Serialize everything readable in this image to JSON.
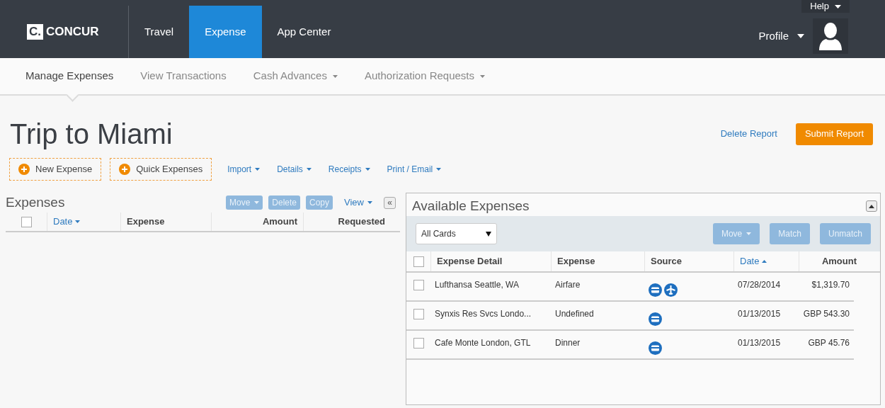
{
  "top_nav": {
    "logo": {
      "mark": "C.",
      "text": "CONCUR"
    },
    "tabs": [
      {
        "label": "Travel",
        "selected": false
      },
      {
        "label": "Expense",
        "selected": true
      },
      {
        "label": "App Center",
        "selected": false
      }
    ],
    "help": "Help",
    "profile": "Profile"
  },
  "sub_nav": [
    {
      "label": "Manage Expenses",
      "selected": true,
      "dropdown": false
    },
    {
      "label": "View Transactions",
      "selected": false,
      "dropdown": false
    },
    {
      "label": "Cash Advances",
      "selected": false,
      "dropdown": true
    },
    {
      "label": "Authorization Requests",
      "selected": false,
      "dropdown": true
    }
  ],
  "report": {
    "title": "Trip to Miami",
    "delete_link": "Delete Report",
    "submit_button": "Submit Report"
  },
  "actions": [
    {
      "kind": "add",
      "label": "New Expense"
    },
    {
      "kind": "add",
      "label": "Quick Expenses"
    },
    {
      "kind": "menu",
      "label": "Import"
    },
    {
      "kind": "menu",
      "label": "Details"
    },
    {
      "kind": "menu",
      "label": "Receipts"
    },
    {
      "kind": "menu",
      "label": "Print / Email"
    }
  ],
  "expenses": {
    "title": "Expenses",
    "buttons": [
      {
        "label": "Move",
        "dropdown": true,
        "disabled": true
      },
      {
        "label": "Delete",
        "dropdown": false,
        "disabled": true
      },
      {
        "label": "Copy",
        "dropdown": false,
        "disabled": true
      }
    ],
    "view": "View",
    "collapse": "«",
    "select_all_checked": false,
    "columns": [
      {
        "label": "Date",
        "sorted": true,
        "ascending": false
      },
      {
        "label": "Expense",
        "sorted": false
      },
      {
        "label": "Amount",
        "sorted": false
      },
      {
        "label": "Requested",
        "sorted": false
      }
    ]
  },
  "available": {
    "title": "Available Expenses",
    "filter": "All Cards",
    "buttons": [
      {
        "label": "Move",
        "dropdown": true,
        "disabled": true
      },
      {
        "label": "Match",
        "dropdown": false,
        "disabled": true
      },
      {
        "label": "Unmatch",
        "dropdown": false,
        "disabled": true
      }
    ],
    "select_all_checked": false,
    "columns": [
      {
        "label": "Expense Detail",
        "sorted": false
      },
      {
        "label": "Expense",
        "sorted": false
      },
      {
        "label": "Source",
        "sorted": false
      },
      {
        "label": "Date",
        "sorted": true,
        "ascending": true
      },
      {
        "label": "Amount",
        "sorted": false
      }
    ],
    "rows": [
      {
        "checked": false,
        "detail": "Lufthansa Seattle, WA",
        "expense": "Airfare",
        "sources": [
          {
            "kind": "card"
          },
          {
            "kind": "plane"
          }
        ],
        "date": "07/28/2014",
        "amount": "$1,319.70"
      },
      {
        "checked": false,
        "detail": "Synxis Res Svcs Londo...",
        "expense": "Undefined",
        "sources": [
          {
            "kind": "card"
          }
        ],
        "date": "01/13/2015",
        "amount": "GBP 543.30"
      },
      {
        "checked": false,
        "detail": "Cafe Monte London, GTL",
        "expense": "Dinner",
        "sources": [
          {
            "kind": "card"
          }
        ],
        "date": "01/13/2015",
        "amount": "GBP 45.76"
      }
    ]
  }
}
